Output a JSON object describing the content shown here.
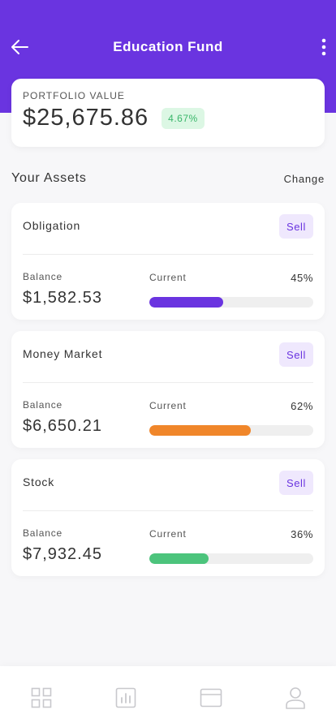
{
  "header": {
    "title": "Education Fund",
    "back_icon": "arrow-left-icon",
    "more_icon": "more-vertical-icon",
    "color": "#6a34e0"
  },
  "portfolio": {
    "label": "PORTFOLIO VALUE",
    "value": "$25,675.86",
    "change": "4.67%"
  },
  "assets_section": {
    "title": "Your Assets",
    "change_label": "Change"
  },
  "assets": [
    {
      "name": "Obligation",
      "sell_label": "Sell",
      "balance_label": "Balance",
      "balance": "$1,582.53",
      "current_label": "Current",
      "percent_label": "45%",
      "percent": 45,
      "color": "#6a34e0"
    },
    {
      "name": "Money Market",
      "sell_label": "Sell",
      "balance_label": "Balance",
      "balance": "$6,650.21",
      "current_label": "Current",
      "percent_label": "62%",
      "percent": 62,
      "color": "#f0862a"
    },
    {
      "name": "Stock",
      "sell_label": "Sell",
      "balance_label": "Balance",
      "balance": "$7,932.45",
      "current_label": "Current",
      "percent_label": "36%",
      "percent": 36,
      "color": "#4cc47c"
    }
  ],
  "tabbar": {
    "icons": [
      "grid-icon",
      "chart-icon",
      "card-icon",
      "user-icon"
    ]
  }
}
